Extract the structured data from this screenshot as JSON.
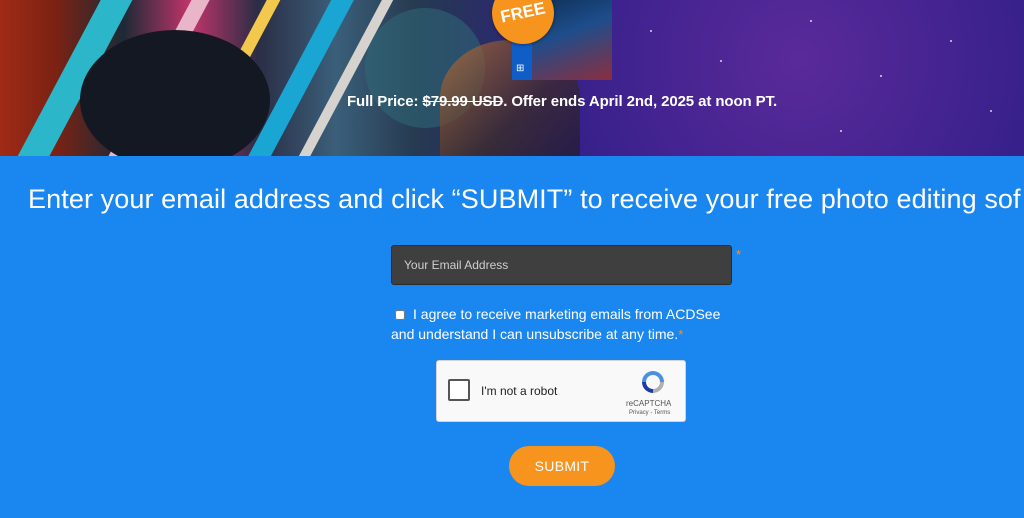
{
  "hero": {
    "badge": "FREE",
    "price_prefix": "Full Price: ",
    "price_old": "$79.99 USD",
    "price_suffix": ". Offer ends April 2nd, 2025 at noon PT."
  },
  "form": {
    "headline": "Enter your email address and click “SUBMIT” to receive your free photo editing sof",
    "email_placeholder": "Your Email Address",
    "required_mark": "*",
    "consent_text": "I agree to receive marketing emails from ACDSee and understand I can unsubscribe at any time.",
    "submit_label": "SUBMIT"
  },
  "captcha": {
    "label": "I'm not a robot",
    "brand": "reCAPTCHA",
    "links": "Privacy - Terms"
  },
  "colors": {
    "background": "#1a86f0",
    "accent": "#f7941d"
  }
}
